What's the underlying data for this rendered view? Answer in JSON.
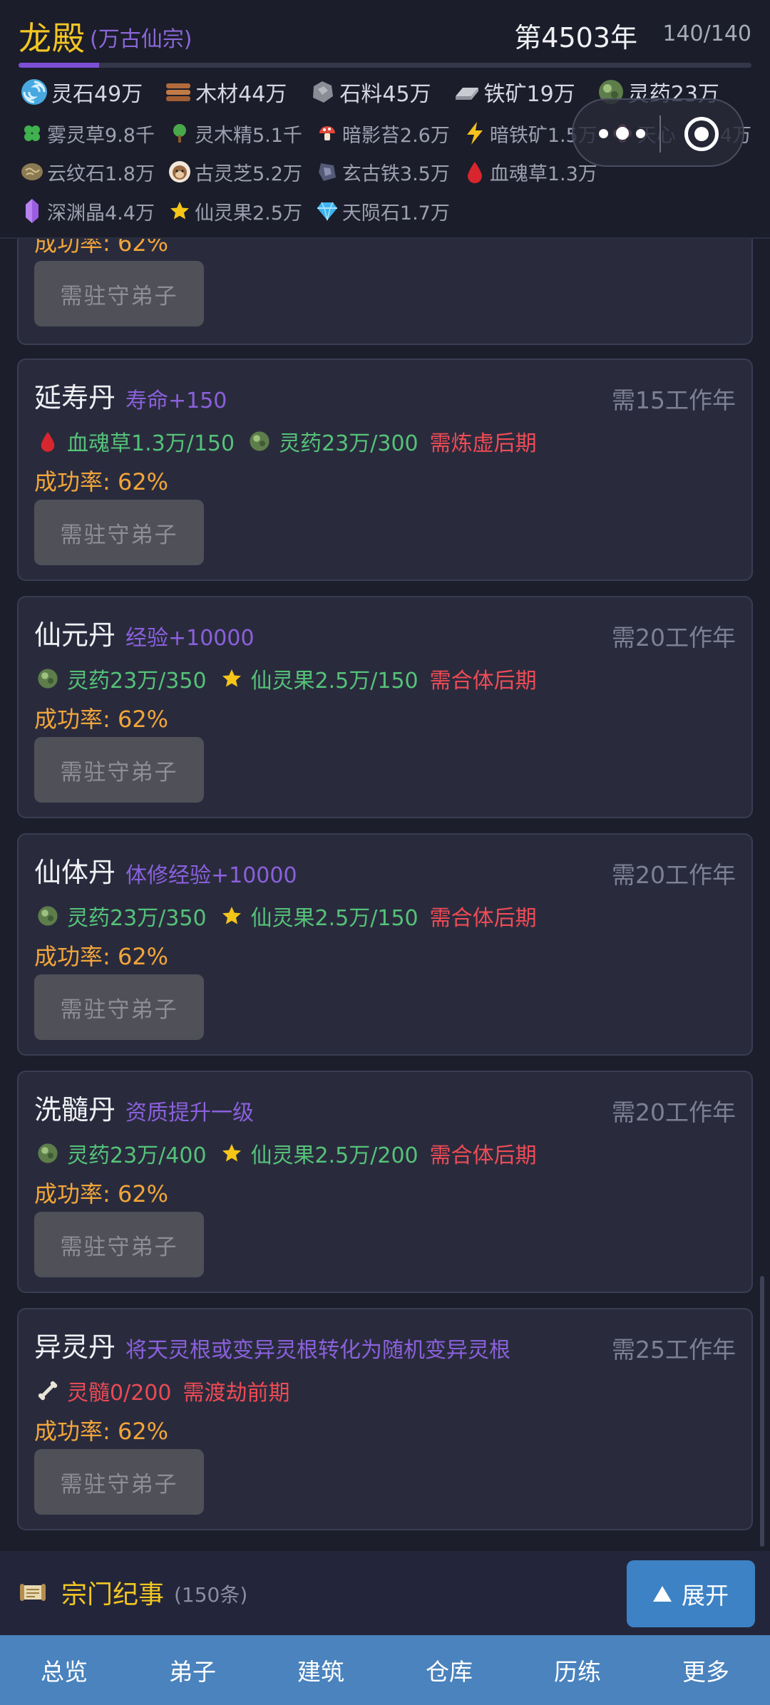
{
  "header": {
    "sect_name": "龙殿",
    "sect_subtitle": "(万古仙宗)",
    "year": "第4503年",
    "count": "140/140",
    "progress": 0.11
  },
  "resources": {
    "row1": [
      {
        "label": "灵石49万",
        "icon": "spirit-stone-icon"
      },
      {
        "label": "木材44万",
        "icon": "wood-icon"
      },
      {
        "label": "石料45万",
        "icon": "stone-icon"
      },
      {
        "label": "铁矿19万",
        "icon": "iron-ore-icon"
      },
      {
        "label": "灵药23万",
        "icon": "herb-orb-icon"
      }
    ],
    "row2": [
      {
        "label": "雾灵草9.8千",
        "icon": "clover-icon"
      },
      {
        "label": "灵木精5.1千",
        "icon": "tree-icon"
      },
      {
        "label": "暗影苔2.6万",
        "icon": "mushroom-icon"
      },
      {
        "label": "暗铁矿1.5万",
        "icon": "lightning-icon"
      },
      {
        "label": "天心",
        "icon": "flower-icon"
      },
      {
        "label": "4万",
        "icon": ""
      }
    ],
    "row3": [
      {
        "label": "云纹石1.8万",
        "icon": "cloud-stone-icon"
      },
      {
        "label": "古灵芝5.2万",
        "icon": "monkey-icon"
      },
      {
        "label": "玄古铁3.5万",
        "icon": "dark-iron-icon"
      },
      {
        "label": "血魂草1.3万",
        "icon": "blood-drop-icon"
      }
    ],
    "row4": [
      {
        "label": "深渊晶4.4万",
        "icon": "crystal-icon"
      },
      {
        "label": "仙灵果2.5万",
        "icon": "star-icon"
      },
      {
        "label": "天陨石1.7万",
        "icon": "diamond-icon"
      }
    ]
  },
  "partial_card": {
    "rate": "成功率: 62%",
    "button": "需驻守弟子"
  },
  "pills": [
    {
      "name": "延寿丹",
      "effect": "寿命+150",
      "time": "需15工作年",
      "reqs": [
        {
          "text": "血魂草1.3万/150",
          "icon": "blood-drop-icon",
          "ok": true
        },
        {
          "text": "灵药23万/300",
          "icon": "herb-orb-icon",
          "ok": true
        }
      ],
      "realm": "需炼虚后期",
      "rate": "成功率: 62%",
      "button": "需驻守弟子"
    },
    {
      "name": "仙元丹",
      "effect": "经验+10000",
      "time": "需20工作年",
      "reqs": [
        {
          "text": "灵药23万/350",
          "icon": "herb-orb-icon",
          "ok": true
        },
        {
          "text": "仙灵果2.5万/150",
          "icon": "star-icon",
          "ok": true
        }
      ],
      "realm": "需合体后期",
      "rate": "成功率: 62%",
      "button": "需驻守弟子"
    },
    {
      "name": "仙体丹",
      "effect": "体修经验+10000",
      "time": "需20工作年",
      "reqs": [
        {
          "text": "灵药23万/350",
          "icon": "herb-orb-icon",
          "ok": true
        },
        {
          "text": "仙灵果2.5万/150",
          "icon": "star-icon",
          "ok": true
        }
      ],
      "realm": "需合体后期",
      "rate": "成功率: 62%",
      "button": "需驻守弟子"
    },
    {
      "name": "洗髓丹",
      "effect": "资质提升一级",
      "time": "需20工作年",
      "reqs": [
        {
          "text": "灵药23万/400",
          "icon": "herb-orb-icon",
          "ok": true
        },
        {
          "text": "仙灵果2.5万/200",
          "icon": "star-icon",
          "ok": true
        }
      ],
      "realm": "需合体后期",
      "rate": "成功率: 62%",
      "button": "需驻守弟子"
    },
    {
      "name": "异灵丹",
      "effect": "将天灵根或变异灵根转化为随机变异灵根",
      "time": "需25工作年",
      "reqs": [
        {
          "text": "灵髓0/200",
          "icon": "bone-icon",
          "ok": false
        }
      ],
      "realm": "需渡劫前期",
      "rate": "成功率: 62%",
      "button": "需驻守弟子"
    }
  ],
  "chronicle": {
    "title": "宗门纪事",
    "count": "(150条)",
    "expand": "展开"
  },
  "tabs": [
    "总览",
    "弟子",
    "建筑",
    "仓库",
    "历练",
    "更多"
  ]
}
